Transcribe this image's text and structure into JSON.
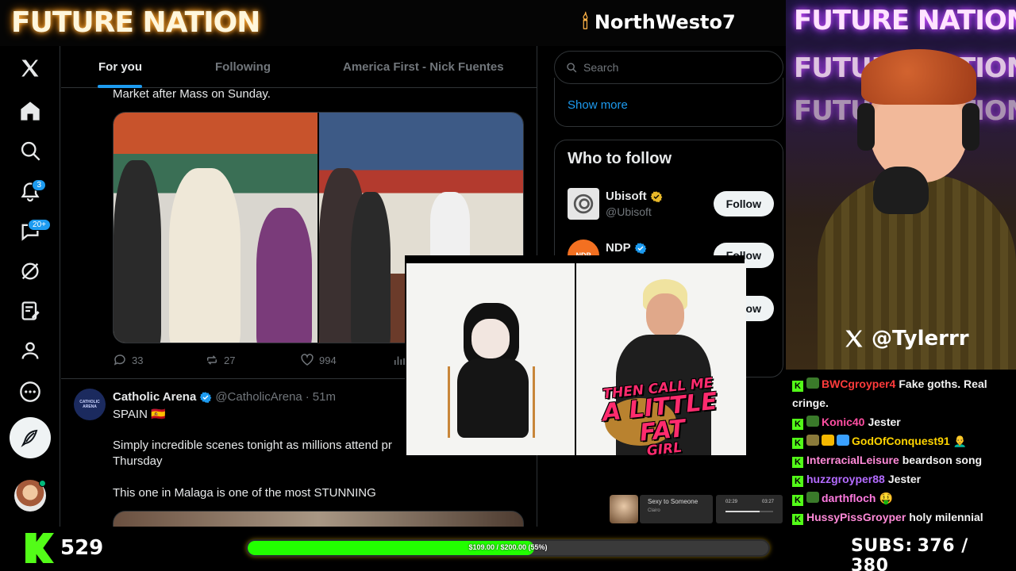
{
  "overlay": {
    "brand": "FUTURE NATION",
    "top_handle": "NorthWesto7",
    "cam_neon": [
      "FUTURE NATION",
      "FUTURE NATION",
      "FUTURE NATION"
    ],
    "cam_handle": "@Tylerrr",
    "viewers": "529",
    "goal": {
      "text": "$109.00 / $200.00 (55%)",
      "fraction": 0.55
    },
    "subs": {
      "label": "SUBS:",
      "value": "376 / 380"
    }
  },
  "nav": {
    "notifications_badge": "3",
    "messages_badge": "20+"
  },
  "feed": {
    "tabs": [
      {
        "label": "For you",
        "active": true
      },
      {
        "label": "Following",
        "active": false
      },
      {
        "label": "America First - Nick Fuentes",
        "active": false
      }
    ],
    "post1": {
      "text_tail": "Market after Mass on Sunday.",
      "stats": {
        "replies": "33",
        "reposts": "27",
        "likes": "994"
      }
    },
    "post2": {
      "avatar_text": "CATHOLIC ARENA",
      "name": "Catholic Arena",
      "handle": "@CatholicArena",
      "sep": "·",
      "time": "51m",
      "line1": "SPAIN 🇪🇸",
      "line2": "Simply incredible scenes tonight as millions attend pr",
      "line3": "Thursday",
      "line4": "This one in Malaga is one of the most STUNNING"
    }
  },
  "sidebar": {
    "search_placeholder": "Search",
    "show_more": "Show more",
    "who_to_follow": "Who to follow",
    "accounts": [
      {
        "name": "Ubisoft",
        "handle": "@Ubisoft",
        "badge": "gold",
        "follow": "Follow"
      },
      {
        "name": "NDP",
        "handle": "",
        "badge": "blue",
        "follow": "Follow",
        "avatar_text": "NDP"
      },
      {
        "name": "",
        "handle": "",
        "follow": "ow"
      }
    ]
  },
  "video": {
    "caption": [
      "THEN CALL ME",
      "A LITTLE FAT",
      "GIRL"
    ]
  },
  "chat": [
    {
      "user": "BWCgroyper4",
      "color": "#ff3b3b",
      "icons": [
        "#3a7a2a"
      ],
      "text": "Fake goths. Real cringe."
    },
    {
      "user": "Konic40",
      "color": "#ff4fa3",
      "icons": [
        "#3a7a2a"
      ],
      "text": "Jester"
    },
    {
      "user": "GodOfConquest91",
      "color": "#ffd400",
      "icons": [
        "#8a7a3a",
        "#f5b800",
        "#3aa0ff"
      ],
      "text": "👨‍🦲"
    },
    {
      "user": "InterracialLeisure",
      "color": "#ff8ad8",
      "icons": [],
      "text": "beardson song"
    },
    {
      "user": "huzzgroyper88",
      "color": "#b36bff",
      "icons": [],
      "text": "Jester"
    },
    {
      "user": "darthfloch",
      "color": "#ff7ae0",
      "icons": [
        "#3a7a2a"
      ],
      "text": "🤑"
    },
    {
      "user": "HussyPissGroyper",
      "color": "#ff8ad8",
      "icons": [],
      "text": "holy milennial"
    }
  ],
  "now_playing": {
    "title": "Sexy to Someone",
    "artist": "Clairo",
    "elapsed": "02:29",
    "total": "03:27",
    "progress": 0.72
  },
  "colors": {
    "x_blue": "#1d9bf0",
    "kick_green": "#53fc18",
    "gold_badge": "#e8b829"
  }
}
